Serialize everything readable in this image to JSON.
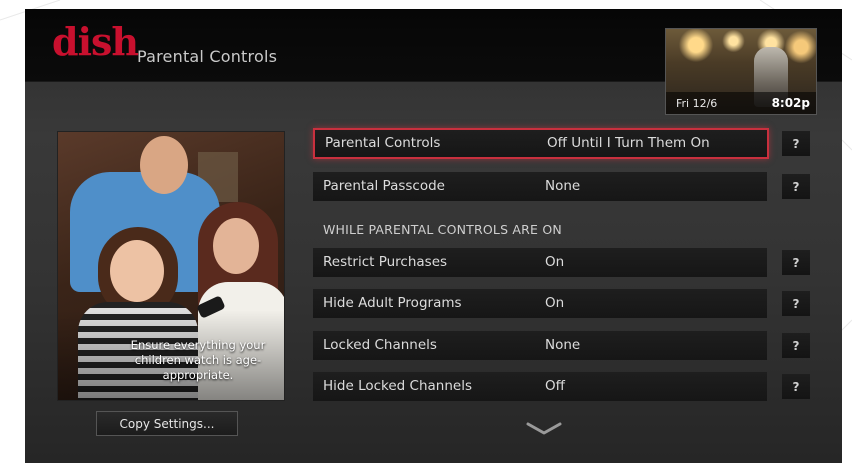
{
  "header": {
    "brand": "dish",
    "title": "Parental Controls"
  },
  "preview": {
    "date": "Fri 12/6",
    "time": "8:02p"
  },
  "photo": {
    "caption": "Ensure everything your children watch is age-appropriate."
  },
  "buttons": {
    "copy_settings": "Copy Settings..."
  },
  "section_heading": "WHILE PARENTAL CONTROLS ARE ON",
  "settings": [
    {
      "label": "Parental Controls",
      "value": "Off Until I Turn Them On"
    },
    {
      "label": "Parental Passcode",
      "value": "None"
    },
    {
      "label": "Restrict Purchases",
      "value": "On"
    },
    {
      "label": "Hide Adult Programs",
      "value": "On"
    },
    {
      "label": "Locked Channels",
      "value": "None"
    },
    {
      "label": "Hide Locked Channels",
      "value": "Off"
    }
  ],
  "help_label": "?",
  "colors": {
    "brand_red": "#c8102e",
    "selection_border": "#c9303e"
  },
  "icons": {
    "help": "question-mark-icon",
    "scroll_down": "chevron-down-icon"
  }
}
